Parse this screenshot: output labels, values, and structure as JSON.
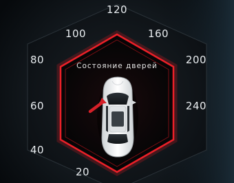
{
  "panel": {
    "title": "Состояние дверей",
    "accent_color": "#e01a22"
  },
  "speedometer": {
    "unit_marks": [
      "20",
      "40",
      "60",
      "80",
      "100",
      "120",
      "160",
      "200",
      "240"
    ]
  },
  "car": {
    "icon": "car-top-view-icon",
    "open_door": "front-left",
    "door_indicator_color": "#d62028"
  }
}
